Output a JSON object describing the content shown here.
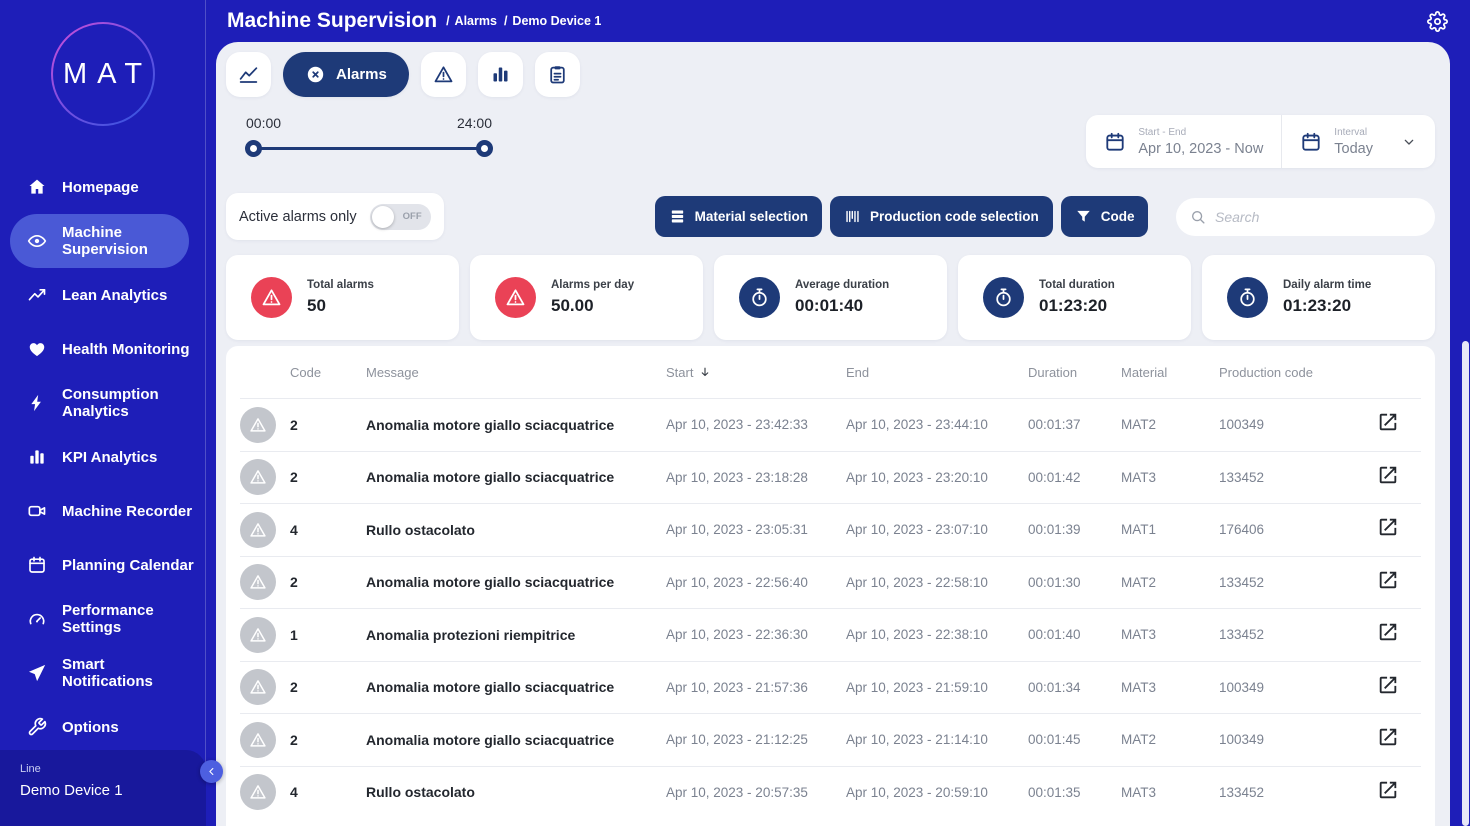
{
  "colors": {
    "background": "#1e1eb8",
    "navy_accent": "#1e3a78",
    "red_accent": "#ea4256",
    "sidebar_active": "#4a59d6",
    "panel_background": "#edeff5"
  },
  "header": {
    "title": "Machine Supervision",
    "breadcrumbs": [
      {
        "sep": "/",
        "label": "Alarms"
      },
      {
        "sep": "/",
        "label": "Demo Device 1"
      }
    ]
  },
  "sidebar": {
    "logo_text": "MAT",
    "items": [
      {
        "label": "Homepage",
        "icon": "home"
      },
      {
        "label": "Machine Supervision",
        "icon": "eye",
        "active": true
      },
      {
        "label": "Lean Analytics",
        "icon": "trend"
      },
      {
        "label": "Health Monitoring",
        "icon": "heart"
      },
      {
        "label": "Consumption Analytics",
        "icon": "bolt"
      },
      {
        "label": "KPI Analytics",
        "icon": "bars"
      },
      {
        "label": "Machine Recorder",
        "icon": "video"
      },
      {
        "label": "Planning Calendar",
        "icon": "calendar"
      },
      {
        "label": "Performance Settings",
        "icon": "gauge"
      },
      {
        "label": "Smart Notifications",
        "icon": "send"
      },
      {
        "label": "Options",
        "icon": "wrench"
      }
    ],
    "device": {
      "label": "Line",
      "value": "Demo Device 1"
    }
  },
  "toolbar": {
    "tabs": [
      {
        "name": "trends",
        "icon": "line-chart"
      },
      {
        "name": "alarms",
        "icon": "circle-x",
        "label": "Alarms",
        "active": true
      },
      {
        "name": "warnings",
        "icon": "warning"
      },
      {
        "name": "statistics",
        "icon": "bar-chart"
      },
      {
        "name": "report",
        "icon": "clipboard"
      }
    ],
    "time_slider": {
      "start": "00:00",
      "end": "24:00"
    },
    "date_range": {
      "label": "Start - End",
      "value": "Apr 10, 2023 - Now"
    },
    "interval": {
      "label": "Interval",
      "value": "Today"
    }
  },
  "filters": {
    "active_only_label": "Active alarms only",
    "toggle_state": "OFF",
    "buttons": [
      {
        "label": "Material selection",
        "icon": "layers"
      },
      {
        "label": "Production code selection",
        "icon": "barcode"
      },
      {
        "label": "Code",
        "icon": "funnel"
      }
    ],
    "search": {
      "placeholder": "Search"
    }
  },
  "stats": [
    {
      "label": "Total alarms",
      "value": "50",
      "icon": "warning",
      "variant": "red"
    },
    {
      "label": "Alarms per day",
      "value": "50.00",
      "icon": "warning",
      "variant": "red"
    },
    {
      "label": "Average duration",
      "value": "00:01:40",
      "icon": "stopwatch",
      "variant": "navy"
    },
    {
      "label": "Total duration",
      "value": "01:23:20",
      "icon": "stopwatch",
      "variant": "navy"
    },
    {
      "label": "Daily alarm time",
      "value": "01:23:20",
      "icon": "stopwatch",
      "variant": "navy"
    }
  ],
  "table": {
    "columns": {
      "code": "Code",
      "message": "Message",
      "start": "Start",
      "end": "End",
      "duration": "Duration",
      "material": "Material",
      "production_code": "Production code"
    },
    "sort": {
      "column": "Start",
      "direction": "desc"
    },
    "rows": [
      {
        "code": "2",
        "message": "Anomalia motore giallo sciacquatrice",
        "start": "Apr 10, 2023 - 23:42:33",
        "end": "Apr 10, 2023 - 23:44:10",
        "duration": "00:01:37",
        "material": "MAT2",
        "production_code": "100349"
      },
      {
        "code": "2",
        "message": "Anomalia motore giallo sciacquatrice",
        "start": "Apr 10, 2023 - 23:18:28",
        "end": "Apr 10, 2023 - 23:20:10",
        "duration": "00:01:42",
        "material": "MAT3",
        "production_code": "133452"
      },
      {
        "code": "4",
        "message": "Rullo ostacolato",
        "start": "Apr 10, 2023 - 23:05:31",
        "end": "Apr 10, 2023 - 23:07:10",
        "duration": "00:01:39",
        "material": "MAT1",
        "production_code": "176406"
      },
      {
        "code": "2",
        "message": "Anomalia motore giallo sciacquatrice",
        "start": "Apr 10, 2023 - 22:56:40",
        "end": "Apr 10, 2023 - 22:58:10",
        "duration": "00:01:30",
        "material": "MAT2",
        "production_code": "133452"
      },
      {
        "code": "1",
        "message": "Anomalia protezioni riempitrice",
        "start": "Apr 10, 2023 - 22:36:30",
        "end": "Apr 10, 2023 - 22:38:10",
        "duration": "00:01:40",
        "material": "MAT3",
        "production_code": "133452"
      },
      {
        "code": "2",
        "message": "Anomalia motore giallo sciacquatrice",
        "start": "Apr 10, 2023 - 21:57:36",
        "end": "Apr 10, 2023 - 21:59:10",
        "duration": "00:01:34",
        "material": "MAT3",
        "production_code": "100349"
      },
      {
        "code": "2",
        "message": "Anomalia motore giallo sciacquatrice",
        "start": "Apr 10, 2023 - 21:12:25",
        "end": "Apr 10, 2023 - 21:14:10",
        "duration": "00:01:45",
        "material": "MAT2",
        "production_code": "100349"
      },
      {
        "code": "4",
        "message": "Rullo ostacolato",
        "start": "Apr 10, 2023 - 20:57:35",
        "end": "Apr 10, 2023 - 20:59:10",
        "duration": "00:01:35",
        "material": "MAT3",
        "production_code": "133452"
      }
    ]
  }
}
